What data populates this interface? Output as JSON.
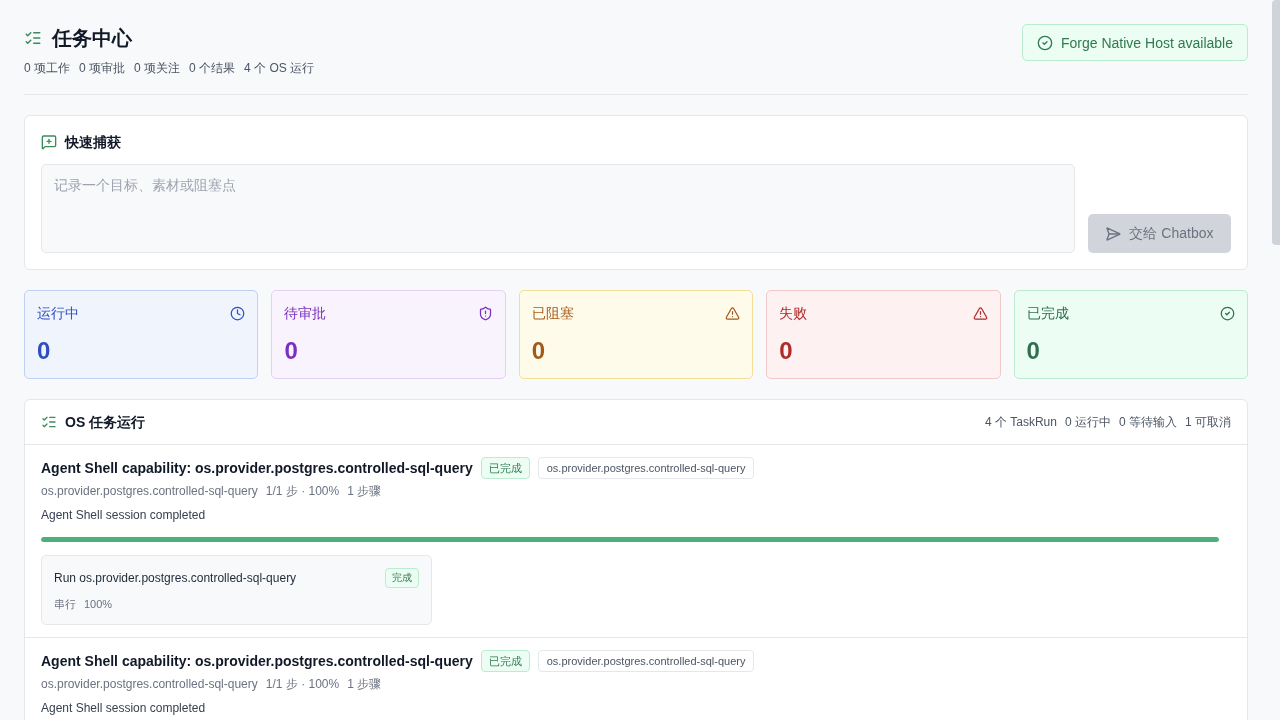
{
  "header": {
    "title": "任务中心",
    "stats": [
      "0 项工作",
      "0 项审批",
      "0 项关注",
      "0 个结果",
      "4 个 OS 运行"
    ],
    "host_status": {
      "label": "Forge Native Host available",
      "available": true
    }
  },
  "quick_capture": {
    "title": "快速捕获",
    "placeholder": "记录一个目标、素材或阻塞点",
    "submit": {
      "label": "交给 Chatbox",
      "disabled": true
    }
  },
  "stat_cards": [
    {
      "kind": "running",
      "label": "运行中",
      "value": "0"
    },
    {
      "kind": "pending",
      "label": "待审批",
      "value": "0"
    },
    {
      "kind": "blocked",
      "label": "已阻塞",
      "value": "0"
    },
    {
      "kind": "failed",
      "label": "失败",
      "value": "0"
    },
    {
      "kind": "done",
      "label": "已完成",
      "value": "0"
    }
  ],
  "os_runs": {
    "title": "OS 任务运行",
    "stats": [
      "4 个 TaskRun",
      "0 运行中",
      "0 等待输入",
      "1 可取消"
    ],
    "runs": [
      {
        "title": "Agent Shell capability: os.provider.postgres.controlled-sql-query",
        "status": {
          "label": "已完成",
          "kind": "done"
        },
        "tag": "os.provider.postgres.controlled-sql-query",
        "meta": [
          "os.provider.postgres.controlled-sql-query",
          "1/1 步 · 100%",
          "1 步骤"
        ],
        "summary": "Agent Shell session completed",
        "progress": {
          "level": 1
        },
        "steps": [
          {
            "title": "Run os.provider.postgres.controlled-sql-query",
            "status": {
              "label": "完成",
              "kind": "done"
            },
            "meta": [
              "串行",
              "100%"
            ]
          }
        ]
      },
      {
        "title": "Agent Shell capability: os.provider.postgres.controlled-sql-query",
        "status": {
          "label": "已完成",
          "kind": "done"
        },
        "tag": "os.provider.postgres.controlled-sql-query",
        "meta": [
          "os.provider.postgres.controlled-sql-query",
          "1/1 步 · 100%",
          "1 步骤"
        ],
        "summary": "Agent Shell session completed"
      }
    ]
  }
}
